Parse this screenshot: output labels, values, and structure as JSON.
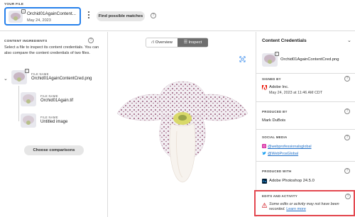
{
  "top": {
    "your_file_label": "YOUR FILE",
    "file": {
      "name": "Orchid01AgainContent...",
      "date": "May 24, 2023"
    },
    "find_button": "Find possible matches",
    "help": "?"
  },
  "left": {
    "heading": "CONTENT INGREDIENTS",
    "help": "?",
    "description": "Select a file to inspect its content credentials. You can also compare the content credentials of two files.",
    "ingredients": [
      {
        "key": "FILE NAME",
        "value": "Orchid01AgainContentCred.png"
      },
      {
        "key": "FILE NAME",
        "value": "Orchid01Again.tif"
      },
      {
        "key": "FILE NAME",
        "value": "Untitled image"
      }
    ],
    "choose_button": "Choose comparisons"
  },
  "center": {
    "tabs": [
      {
        "label": "Overview",
        "selected": false
      },
      {
        "label": "Inspect",
        "selected": true
      }
    ]
  },
  "right": {
    "title": "Content Credentials",
    "file_name": "Orchid01AgainContentCred.png",
    "signed_by": {
      "label": "SIGNED BY",
      "name": "Adobe Inc.",
      "date": "May 24, 2023 at 11:46 AM CDT"
    },
    "produced_by": {
      "label": "PRODUCED BY",
      "name": "Mark DuBois"
    },
    "social_media": {
      "label": "SOCIAL MEDIA",
      "accounts": [
        {
          "network": "instagram",
          "handle": "@webprofessionalsglobal"
        },
        {
          "network": "twitter",
          "handle": "@WebProsGlobal"
        }
      ]
    },
    "produced_with": {
      "label": "PRODUCED WITH",
      "app": "Adobe Photoshop 24.5.0"
    },
    "edits": {
      "label": "EDITS AND ACTIVITY",
      "text": "Some edits or activity may not have been recorded.",
      "link": "Learn more"
    }
  },
  "colors": {
    "accent": "#2680eb",
    "alert": "#e34850",
    "link": "#1f6fc7"
  }
}
